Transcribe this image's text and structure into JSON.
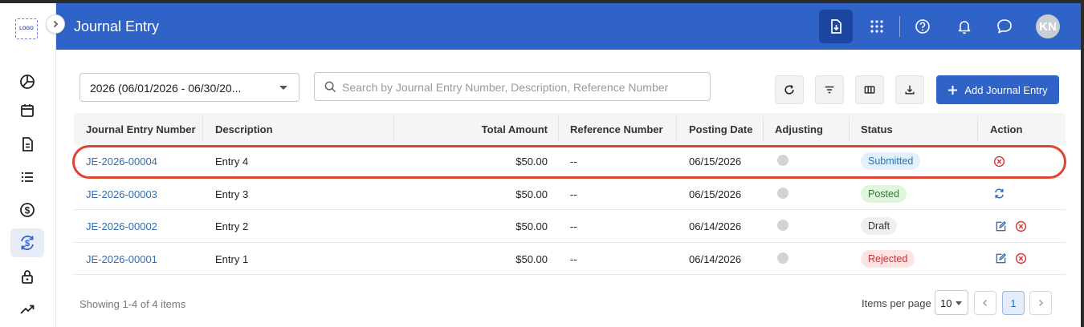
{
  "app": {
    "logo_text": "LOGO",
    "title": "Journal Entry",
    "user_initials": "KN"
  },
  "colors": {
    "brand": "#2f63c8",
    "highlight": "#e0432f",
    "link": "#2f6fb5"
  },
  "sidebar": {
    "items": [
      {
        "name": "pie-chart-icon"
      },
      {
        "name": "calendar-icon"
      },
      {
        "name": "document-icon"
      },
      {
        "name": "list-icon"
      },
      {
        "name": "dollar-icon"
      },
      {
        "name": "dollar-refresh-icon",
        "active": true
      },
      {
        "name": "lock-icon"
      },
      {
        "name": "trend-up-icon"
      }
    ]
  },
  "header_icons": [
    "download-document-icon",
    "apps-grid-icon",
    "help-icon",
    "bell-icon",
    "chat-icon"
  ],
  "toolbar": {
    "date_range": "2026 (06/01/2026 - 06/30/20...",
    "search_placeholder": "Search by Journal Entry Number, Description, Reference Number",
    "search_value": "",
    "add_label": "Add Journal Entry"
  },
  "table": {
    "columns": [
      "Journal Entry Number",
      "Description",
      "Total Amount",
      "Reference Number",
      "Posting Date",
      "Adjusting",
      "Status",
      "Action"
    ],
    "rows": [
      {
        "number": "JE-2026-00004",
        "description": "Entry 4",
        "amount": "$50.00",
        "reference": "--",
        "date": "06/15/2026",
        "status": "Submitted",
        "status_kind": "submitted",
        "actions": [
          "cancel"
        ]
      },
      {
        "number": "JE-2026-00003",
        "description": "Entry 3",
        "amount": "$50.00",
        "reference": "--",
        "date": "06/15/2026",
        "status": "Posted",
        "status_kind": "posted",
        "actions": [
          "reverse"
        ]
      },
      {
        "number": "JE-2026-00002",
        "description": "Entry 2",
        "amount": "$50.00",
        "reference": "--",
        "date": "06/14/2026",
        "status": "Draft",
        "status_kind": "draft",
        "actions": [
          "edit",
          "cancel"
        ]
      },
      {
        "number": "JE-2026-00001",
        "description": "Entry 1",
        "amount": "$50.00",
        "reference": "--",
        "date": "06/14/2026",
        "status": "Rejected",
        "status_kind": "rejected",
        "actions": [
          "edit",
          "cancel"
        ]
      }
    ]
  },
  "footer": {
    "showing": "Showing 1-4 of 4 items",
    "items_per_page_label": "Items per page",
    "items_per_page": "10",
    "current_page": "1"
  }
}
